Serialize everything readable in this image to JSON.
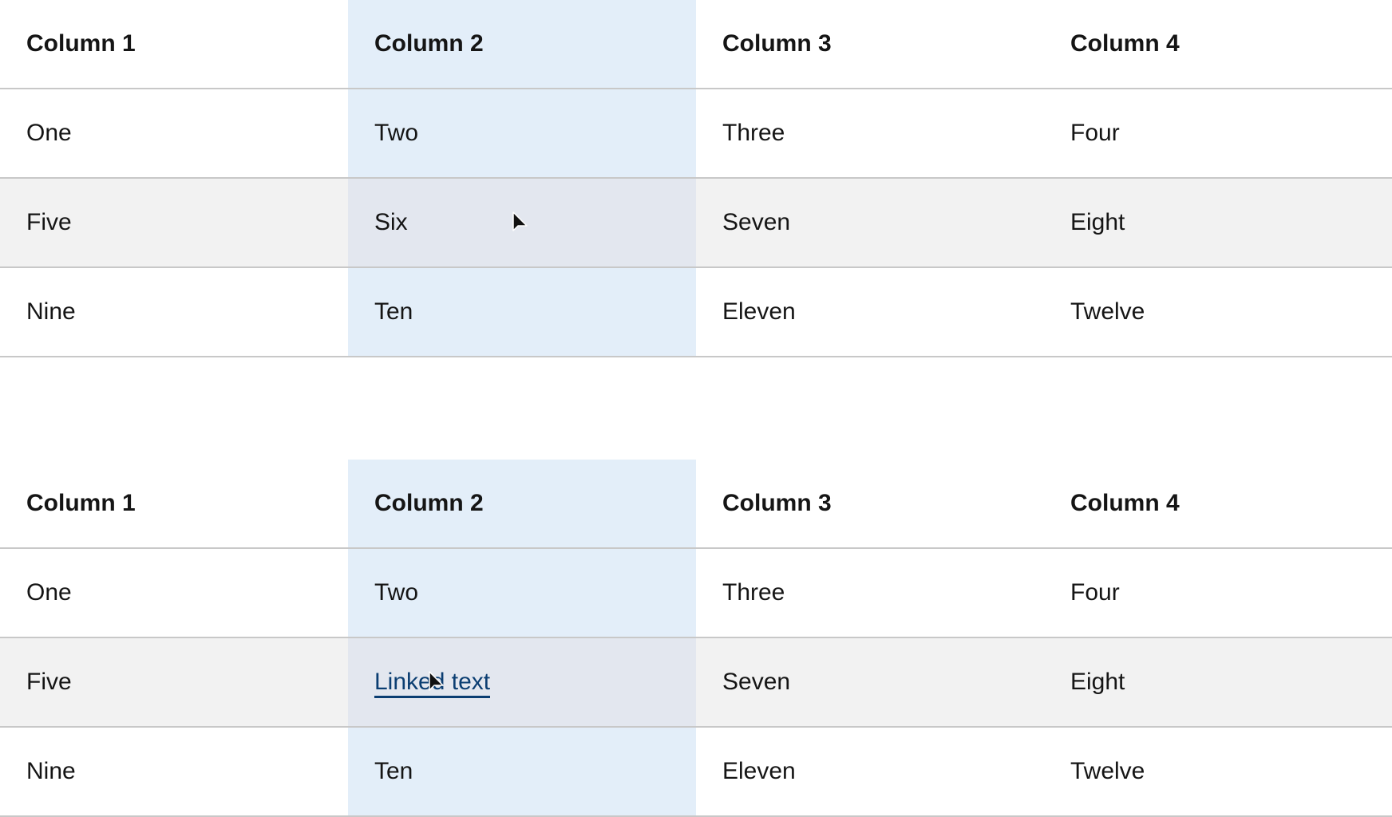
{
  "tables": [
    {
      "headers": [
        "Column 1",
        "Column 2",
        "Column 3",
        "Column 4"
      ],
      "highlighted_column": "Column 2",
      "hovered_row": 2,
      "rows": [
        [
          "One",
          "Two",
          "Three",
          "Four"
        ],
        [
          "Five",
          "Six",
          "Seven",
          "Eight"
        ],
        [
          "Nine",
          "Ten",
          "Eleven",
          "Twelve"
        ]
      ]
    },
    {
      "headers": [
        "Column 1",
        "Column 2",
        "Column 3",
        "Column 4"
      ],
      "highlighted_column": "Column 2",
      "hovered_row": 2,
      "rows": [
        [
          "One",
          "Two",
          "Three",
          "Four"
        ],
        [
          "Five",
          "Linked text",
          "Seven",
          "Eight"
        ],
        [
          "Nine",
          "Ten",
          "Eleven",
          "Twelve"
        ]
      ],
      "link_cell": {
        "row": 2,
        "column": 2,
        "text": "Linked text"
      }
    }
  ],
  "colors": {
    "column_highlight": "#e3eef9",
    "row_hover": "#f2f2f2",
    "intersection": "#e3e7ef",
    "border": "#c8c8c8",
    "link": "#0b3e72"
  },
  "icons": {
    "cursor": "mouse-pointer-icon"
  }
}
